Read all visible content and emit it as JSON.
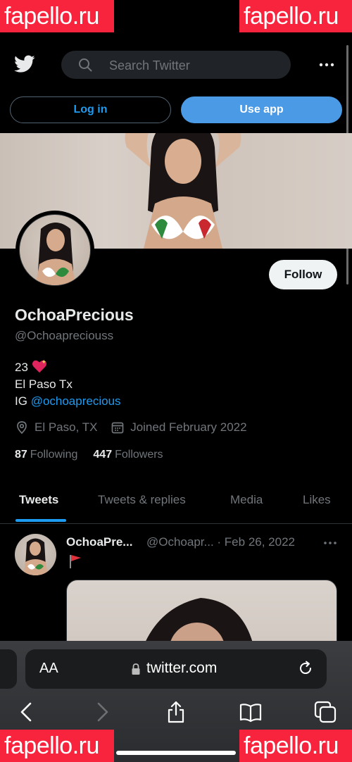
{
  "watermark": "fapello.ru",
  "statusbar": {
    "time": "",
    "signal": ""
  },
  "topbar": {
    "search_placeholder": "Search Twitter"
  },
  "buttons": {
    "login": "Log in",
    "use_app": "Use app",
    "follow": "Follow"
  },
  "profile": {
    "display_name": "OchoaPrecious",
    "handle": "@Ochoapreciouss",
    "bio_line1": "23",
    "bio_line2": "El Paso Tx",
    "bio_ig_prefix": "IG",
    "bio_ig_link": "@ochoaprecious",
    "location": "El Paso, TX",
    "joined": "Joined February 2022",
    "following_count": "87",
    "following_label": "Following",
    "followers_count": "447",
    "followers_label": "Followers"
  },
  "tabs": [
    {
      "label": "Tweets",
      "active": true
    },
    {
      "label": "Tweets & replies",
      "active": false
    },
    {
      "label": "Media",
      "active": false
    },
    {
      "label": "Likes",
      "active": false
    }
  ],
  "tweet": {
    "name": "OchoaPre...",
    "handle_date": "@Ochoapr... · Feb 26, 2022"
  },
  "safari": {
    "text_size": "AA",
    "url": "twitter.com"
  },
  "colors": {
    "accent": "#1d9bf0",
    "use_app_bg": "#4a9ae6",
    "watermark_bg": "#f8243d"
  }
}
